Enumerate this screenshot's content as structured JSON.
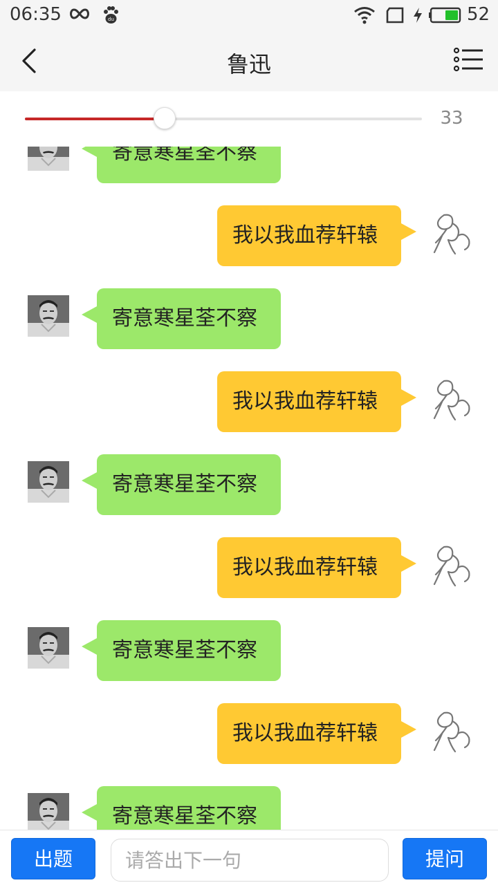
{
  "status_bar": {
    "time": "06:35",
    "battery_percent": "52",
    "icons": [
      "infinity-icon",
      "baidu-paw-icon",
      "wifi-icon",
      "sim-icon",
      "charging-bolt-icon",
      "battery-icon"
    ]
  },
  "header": {
    "title": "鲁迅",
    "back_icon": "chevron-left-icon",
    "menu_icon": "list-menu-icon"
  },
  "progress": {
    "fraction": 0.33,
    "value_text": "33",
    "fill_color": "#c62828"
  },
  "messages": [
    {
      "side": "left",
      "text": "寄意寒星荃不察"
    },
    {
      "side": "right",
      "text": "我以我血荐轩辕"
    },
    {
      "side": "left",
      "text": "寄意寒星荃不察"
    },
    {
      "side": "right",
      "text": "我以我血荐轩辕"
    },
    {
      "side": "left",
      "text": "寄意寒星荃不察"
    },
    {
      "side": "right",
      "text": "我以我血荐轩辕"
    },
    {
      "side": "left",
      "text": "寄意寒星荃不察"
    },
    {
      "side": "right",
      "text": "我以我血荐轩辕"
    },
    {
      "side": "left",
      "text": "寄意寒星荃不察"
    }
  ],
  "colors": {
    "left_bubble": "#9ce86a",
    "right_bubble": "#ffc933",
    "primary_button": "#1677f5"
  },
  "bottom": {
    "left_button": "出题",
    "input_placeholder": "请答出下一句",
    "input_value": "",
    "right_button": "提问"
  }
}
